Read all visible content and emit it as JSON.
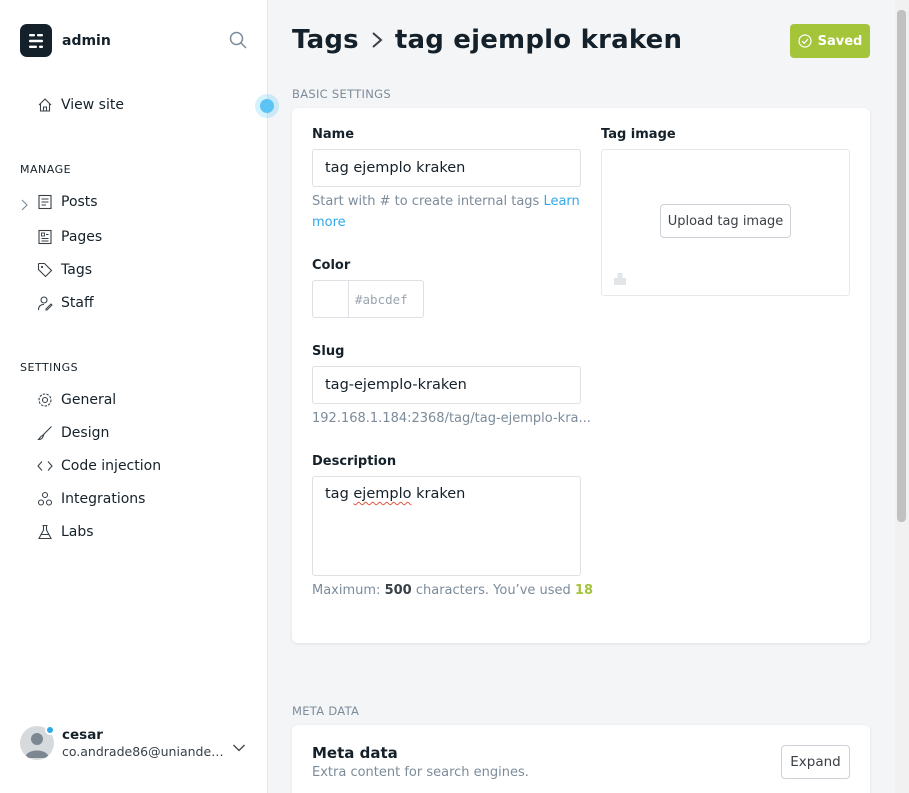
{
  "sidebar": {
    "brand": "admin",
    "view_site": "View site",
    "manage_heading": "MANAGE",
    "manage_items": [
      "Posts",
      "Pages",
      "Tags",
      "Staff"
    ],
    "settings_heading": "SETTINGS",
    "settings_items": [
      "General",
      "Design",
      "Code injection",
      "Integrations",
      "Labs"
    ],
    "user": {
      "name": "cesar",
      "email": "co.andrade86@uniandes.edu.co"
    }
  },
  "header": {
    "breadcrumb_parent": "Tags",
    "breadcrumb_current": "tag ejemplo kraken",
    "saved_label": "Saved"
  },
  "basic": {
    "section_label": "BASIC SETTINGS",
    "name_label": "Name",
    "name_value": "tag ejemplo kraken",
    "name_hint": "Start with # to create internal tags",
    "name_hint_link": "Learn more",
    "color_label": "Color",
    "color_placeholder": "#abcdef",
    "slug_label": "Slug",
    "slug_value": "tag-ejemplo-kraken",
    "slug_url": "192.168.1.184:2368/tag/tag-ejemplo-kra...",
    "description_label": "Description",
    "description_value": "tag ejemplo kraken",
    "desc_hint_prefix": "Maximum:",
    "desc_max": "500",
    "desc_hint_mid": "characters. You’ve used",
    "desc_used": "18",
    "image_label": "Tag image",
    "upload_label": "Upload tag image"
  },
  "meta": {
    "section_label": "META DATA",
    "title": "Meta data",
    "subtitle": "Extra content for search engines.",
    "expand_label": "Expand"
  },
  "colors": {
    "accent_green": "#a4c43a",
    "link_blue": "#30a9e8",
    "dark": "#15212a"
  }
}
